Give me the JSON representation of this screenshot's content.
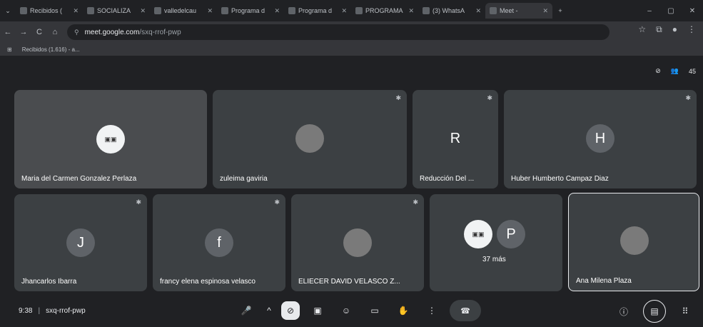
{
  "browser": {
    "tabs": [
      {
        "title": "Recibidos (",
        "active": false
      },
      {
        "title": "SOCIALIZA",
        "active": false
      },
      {
        "title": "valledelcau",
        "active": false
      },
      {
        "title": "Programa d",
        "active": false
      },
      {
        "title": "Programa d",
        "active": false
      },
      {
        "title": "PROGRAMA",
        "active": false
      },
      {
        "title": "(3) WhatsA",
        "active": false
      },
      {
        "title": "Meet -",
        "active": true
      }
    ],
    "new_tab": "+",
    "url_host": "meet.google.com",
    "url_path": "/sxq-rrof-pwp",
    "bookmark": "Recibidos (1.616) - a..."
  },
  "top_right": {
    "participant_count": "45"
  },
  "participants": [
    {
      "name": "Maria del Carmen Gonzalez Perlaza",
      "avatar_type": "logo",
      "avatar_text": "",
      "highlight": true
    },
    {
      "name": "zuleima gaviria",
      "avatar_type": "photo",
      "avatar_text": ""
    },
    {
      "name": "Reducción Del ...",
      "avatar_type": "letter",
      "avatar_text": "R"
    },
    {
      "name": "Huber Humberto Campaz Diaz",
      "avatar_type": "letter",
      "avatar_text": "H"
    },
    {
      "name": "Jhancarlos Ibarra",
      "avatar_type": "letter",
      "avatar_text": "J"
    },
    {
      "name": "francy elena espinosa velasco",
      "avatar_type": "letter",
      "avatar_text": "f"
    },
    {
      "name": "ELIECER DAVID VELASCO Z...",
      "avatar_type": "photo",
      "avatar_text": ""
    },
    {
      "name": "",
      "avatar_type": "group",
      "avatar_text": "P",
      "more": "37 más"
    },
    {
      "name": "Ana Milena Plaza",
      "avatar_type": "photo",
      "avatar_text": ""
    }
  ],
  "bottom": {
    "time": "9:38",
    "meeting_code": "sxq-rrof-pwp"
  }
}
